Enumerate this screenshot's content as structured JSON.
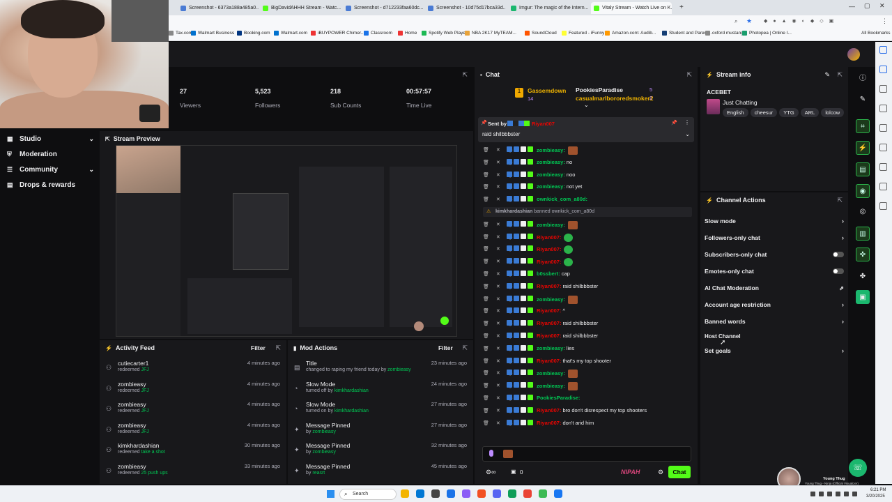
{
  "browser": {
    "tabs": [
      {
        "label": "Screenshot - 6373a188a485a0...",
        "color": "#4a7bd4"
      },
      {
        "label": "BigDavidAHHH Stream - Watc...",
        "color": "#53fc18"
      },
      {
        "label": "Screenshot - d712233faa60dc...",
        "color": "#4a7bd4"
      },
      {
        "label": "Screenshot - 10d75d17bca33d...",
        "color": "#4a7bd4"
      },
      {
        "label": "Imgur: The magic of the Intern...",
        "color": "#1bb76e"
      },
      {
        "label": "Vitaly Stream - Watch Live on K...",
        "color": "#53fc18"
      }
    ],
    "new_tab": "+",
    "bookmarks": [
      "Tax.com",
      "Walmart Business",
      "Booking.com",
      "Walmart.com",
      "iBUYPOWER Chimer...",
      "Classroom",
      "Home",
      "Spotify Web Player",
      "NBA 2K17 MyTEAM...",
      "SoundCloud",
      "Featured - iFunny :)",
      "Amazon.com: Audib...",
      "Student and Parent...",
      "oxford mustang",
      "Photopea | Online I..."
    ],
    "all_bookmarks": "All Bookmarks"
  },
  "sidebar": {
    "items": [
      {
        "label": "Studio",
        "icon": "studio-icon",
        "chevron": "⌄"
      },
      {
        "label": "Moderation",
        "icon": "moderation-icon",
        "chevron": ""
      },
      {
        "label": "Community",
        "icon": "community-icon",
        "chevron": "⌄"
      },
      {
        "label": "Drops & rewards",
        "icon": "gift-icon",
        "chevron": ""
      }
    ]
  },
  "stats": [
    {
      "value": "27",
      "label": "Viewers"
    },
    {
      "value": "5,523",
      "label": "Followers"
    },
    {
      "value": "218",
      "label": "Sub Counts"
    },
    {
      "value": "00:57:57",
      "label": "Time Live"
    }
  ],
  "stream_preview": {
    "title": "Stream Preview"
  },
  "activity_feed": {
    "title": "Activity Feed",
    "filter": "Filter",
    "rows": [
      {
        "user": "cutiecarter1",
        "action": "redeemed",
        "reward": "JFJ",
        "time": "4 minutes ago"
      },
      {
        "user": "zombieasy",
        "action": "redeemed",
        "reward": "JFJ",
        "time": "4 minutes ago"
      },
      {
        "user": "zombieasy",
        "action": "redeemed",
        "reward": "JFJ",
        "time": "4 minutes ago"
      },
      {
        "user": "zombieasy",
        "action": "redeemed",
        "reward": "JFJ",
        "time": "4 minutes ago"
      },
      {
        "user": "kimkhardashian",
        "action": "redeemed",
        "reward": "take a shot",
        "time": "30 minutes ago"
      },
      {
        "user": "zombieasy",
        "action": "redeemed",
        "reward": "25 push ups",
        "time": "33 minutes ago"
      }
    ]
  },
  "mod_actions": {
    "title": "Mod Actions",
    "filter": "Filter",
    "rows": [
      {
        "title": "Title",
        "detail": "changed to raping my friend today",
        "by": "by",
        "user": "zombieasy",
        "time": "23 minutes ago",
        "icon": "title-icon"
      },
      {
        "title": "Slow Mode",
        "detail": "turned off",
        "by": "by",
        "user": "kimkhardashian",
        "time": "24 minutes ago",
        "icon": "slow-mode-icon"
      },
      {
        "title": "Slow Mode",
        "detail": "turned on",
        "by": "by",
        "user": "kimkhardashian",
        "time": "27 minutes ago",
        "icon": "slow-mode-icon"
      },
      {
        "title": "Message Pinned",
        "detail": "",
        "by": "by",
        "user": "zombieasy",
        "time": "27 minutes ago",
        "icon": "pin-icon"
      },
      {
        "title": "Message Pinned",
        "detail": "",
        "by": "by",
        "user": "zombieasy",
        "time": "32 minutes ago",
        "icon": "pin-icon"
      },
      {
        "title": "Message Pinned",
        "detail": "",
        "by": "by",
        "user": "reasrt",
        "time": "45 minutes ago",
        "icon": "pin-icon"
      }
    ]
  },
  "chat": {
    "title": "Chat",
    "leaders": [
      {
        "name": "Gassemdown",
        "count": "14"
      },
      {
        "name": "PookiesParadise",
        "count": "5"
      },
      {
        "name": "casualmarlbororedsmoker2",
        "count": "2"
      }
    ],
    "pinned": {
      "sent_by": "Sent by",
      "user": "Riyan007",
      "message": "raid shilbbbster"
    },
    "messages": [
      {
        "user": "zombieasy",
        "color": "#00c854",
        "text": "",
        "emote": true,
        "kind": "normal"
      },
      {
        "user": "zombieasy",
        "color": "#00c854",
        "text": "no",
        "emote": false,
        "kind": "normal"
      },
      {
        "user": "zombieasy",
        "color": "#00c854",
        "text": "noo",
        "emote": false,
        "kind": "normal"
      },
      {
        "user": "zombieasy",
        "color": "#00c854",
        "text": "not yet",
        "emote": false,
        "kind": "normal"
      },
      {
        "user": "ownkick_com_a80d",
        "color": "#00c854",
        "text": "",
        "emote": false,
        "kind": "normal"
      },
      {
        "user": "kimkhardashian",
        "color": "#adadb8",
        "text": "banned ownkick_com_a80d",
        "emote": false,
        "kind": "system"
      },
      {
        "user": "zombieasy",
        "color": "#00c854",
        "text": "",
        "emote": true,
        "kind": "normal"
      },
      {
        "user": "Riyan007",
        "color": "#eb0400",
        "text": "",
        "emote": true,
        "kind": "green"
      },
      {
        "user": "Riyan007",
        "color": "#eb0400",
        "text": "",
        "emote": true,
        "kind": "green"
      },
      {
        "user": "Riyan007",
        "color": "#eb0400",
        "text": "",
        "emote": true,
        "kind": "green"
      },
      {
        "user": "b0ssbert",
        "color": "#00c854",
        "text": "cap",
        "emote": false,
        "kind": "normal"
      },
      {
        "user": "Riyan007",
        "color": "#eb0400",
        "text": "raid shilbbbster",
        "emote": false,
        "kind": "normal"
      },
      {
        "user": "zombieasy",
        "color": "#00c854",
        "text": "",
        "emote": true,
        "kind": "normal"
      },
      {
        "user": "Riyan007",
        "color": "#eb0400",
        "text": "^",
        "emote": false,
        "kind": "normal"
      },
      {
        "user": "Riyan007",
        "color": "#eb0400",
        "text": "raid shilbbbster",
        "emote": false,
        "kind": "normal"
      },
      {
        "user": "Riyan007",
        "color": "#eb0400",
        "text": "raid shilbbbster",
        "emote": false,
        "kind": "normal"
      },
      {
        "user": "zombieasy",
        "color": "#00c854",
        "text": "lies",
        "emote": false,
        "kind": "normal"
      },
      {
        "user": "Riyan007",
        "color": "#eb0400",
        "text": "that's my top shooter",
        "emote": false,
        "kind": "normal"
      },
      {
        "user": "zombieasy",
        "color": "#00c854",
        "text": "",
        "emote": true,
        "kind": "normal"
      },
      {
        "user": "zombieasy",
        "color": "#00c854",
        "text": "",
        "emote": true,
        "kind": "normal"
      },
      {
        "user": "PookiesParadise",
        "color": "#00c854",
        "text": "",
        "emote": false,
        "kind": "normal"
      },
      {
        "user": "Riyan007",
        "color": "#eb0400",
        "text": "bro don't disrespect my top shooters",
        "emote": false,
        "kind": "normal"
      },
      {
        "user": "Riyan007",
        "color": "#eb0400",
        "text": "don't arid him",
        "emote": false,
        "kind": "normal"
      }
    ],
    "footer": {
      "points": "0",
      "brand": "NIPAH",
      "send_label": "Chat"
    }
  },
  "stream_info": {
    "title": "Stream info",
    "channel": "ACEBET",
    "category": "Just Chatting",
    "tags": [
      "English",
      "cheesur",
      "YTG",
      "ARL",
      "lolcow"
    ]
  },
  "channel_actions": {
    "title": "Channel Actions",
    "rows": [
      {
        "label": "Slow mode",
        "control": "chevron"
      },
      {
        "label": "Followers-only chat",
        "control": "chevron"
      },
      {
        "label": "Subscribers-only chat",
        "control": "toggle"
      },
      {
        "label": "Emotes-only chat",
        "control": "toggle"
      },
      {
        "label": "AI Chat Moderation",
        "control": "external"
      },
      {
        "label": "Account age restriction",
        "control": "chevron"
      },
      {
        "label": "Banned words",
        "control": "chevron"
      },
      {
        "label": "Host Channel",
        "control": "none"
      },
      {
        "label": "Set goals",
        "control": "chevron"
      }
    ]
  },
  "music": {
    "title": "Young Thug",
    "subtitle": "Young Thug - Ninja (Official Visualizer)"
  },
  "taskbar": {
    "search": "Search",
    "time": "6:21 PM",
    "date": "3/20/2025"
  },
  "colors": {
    "kick_green": "#53fc18",
    "accent_green": "#00c854",
    "red_user": "#eb0400",
    "panel_bg": "#18181b",
    "page_bg": "#0e0e10"
  }
}
